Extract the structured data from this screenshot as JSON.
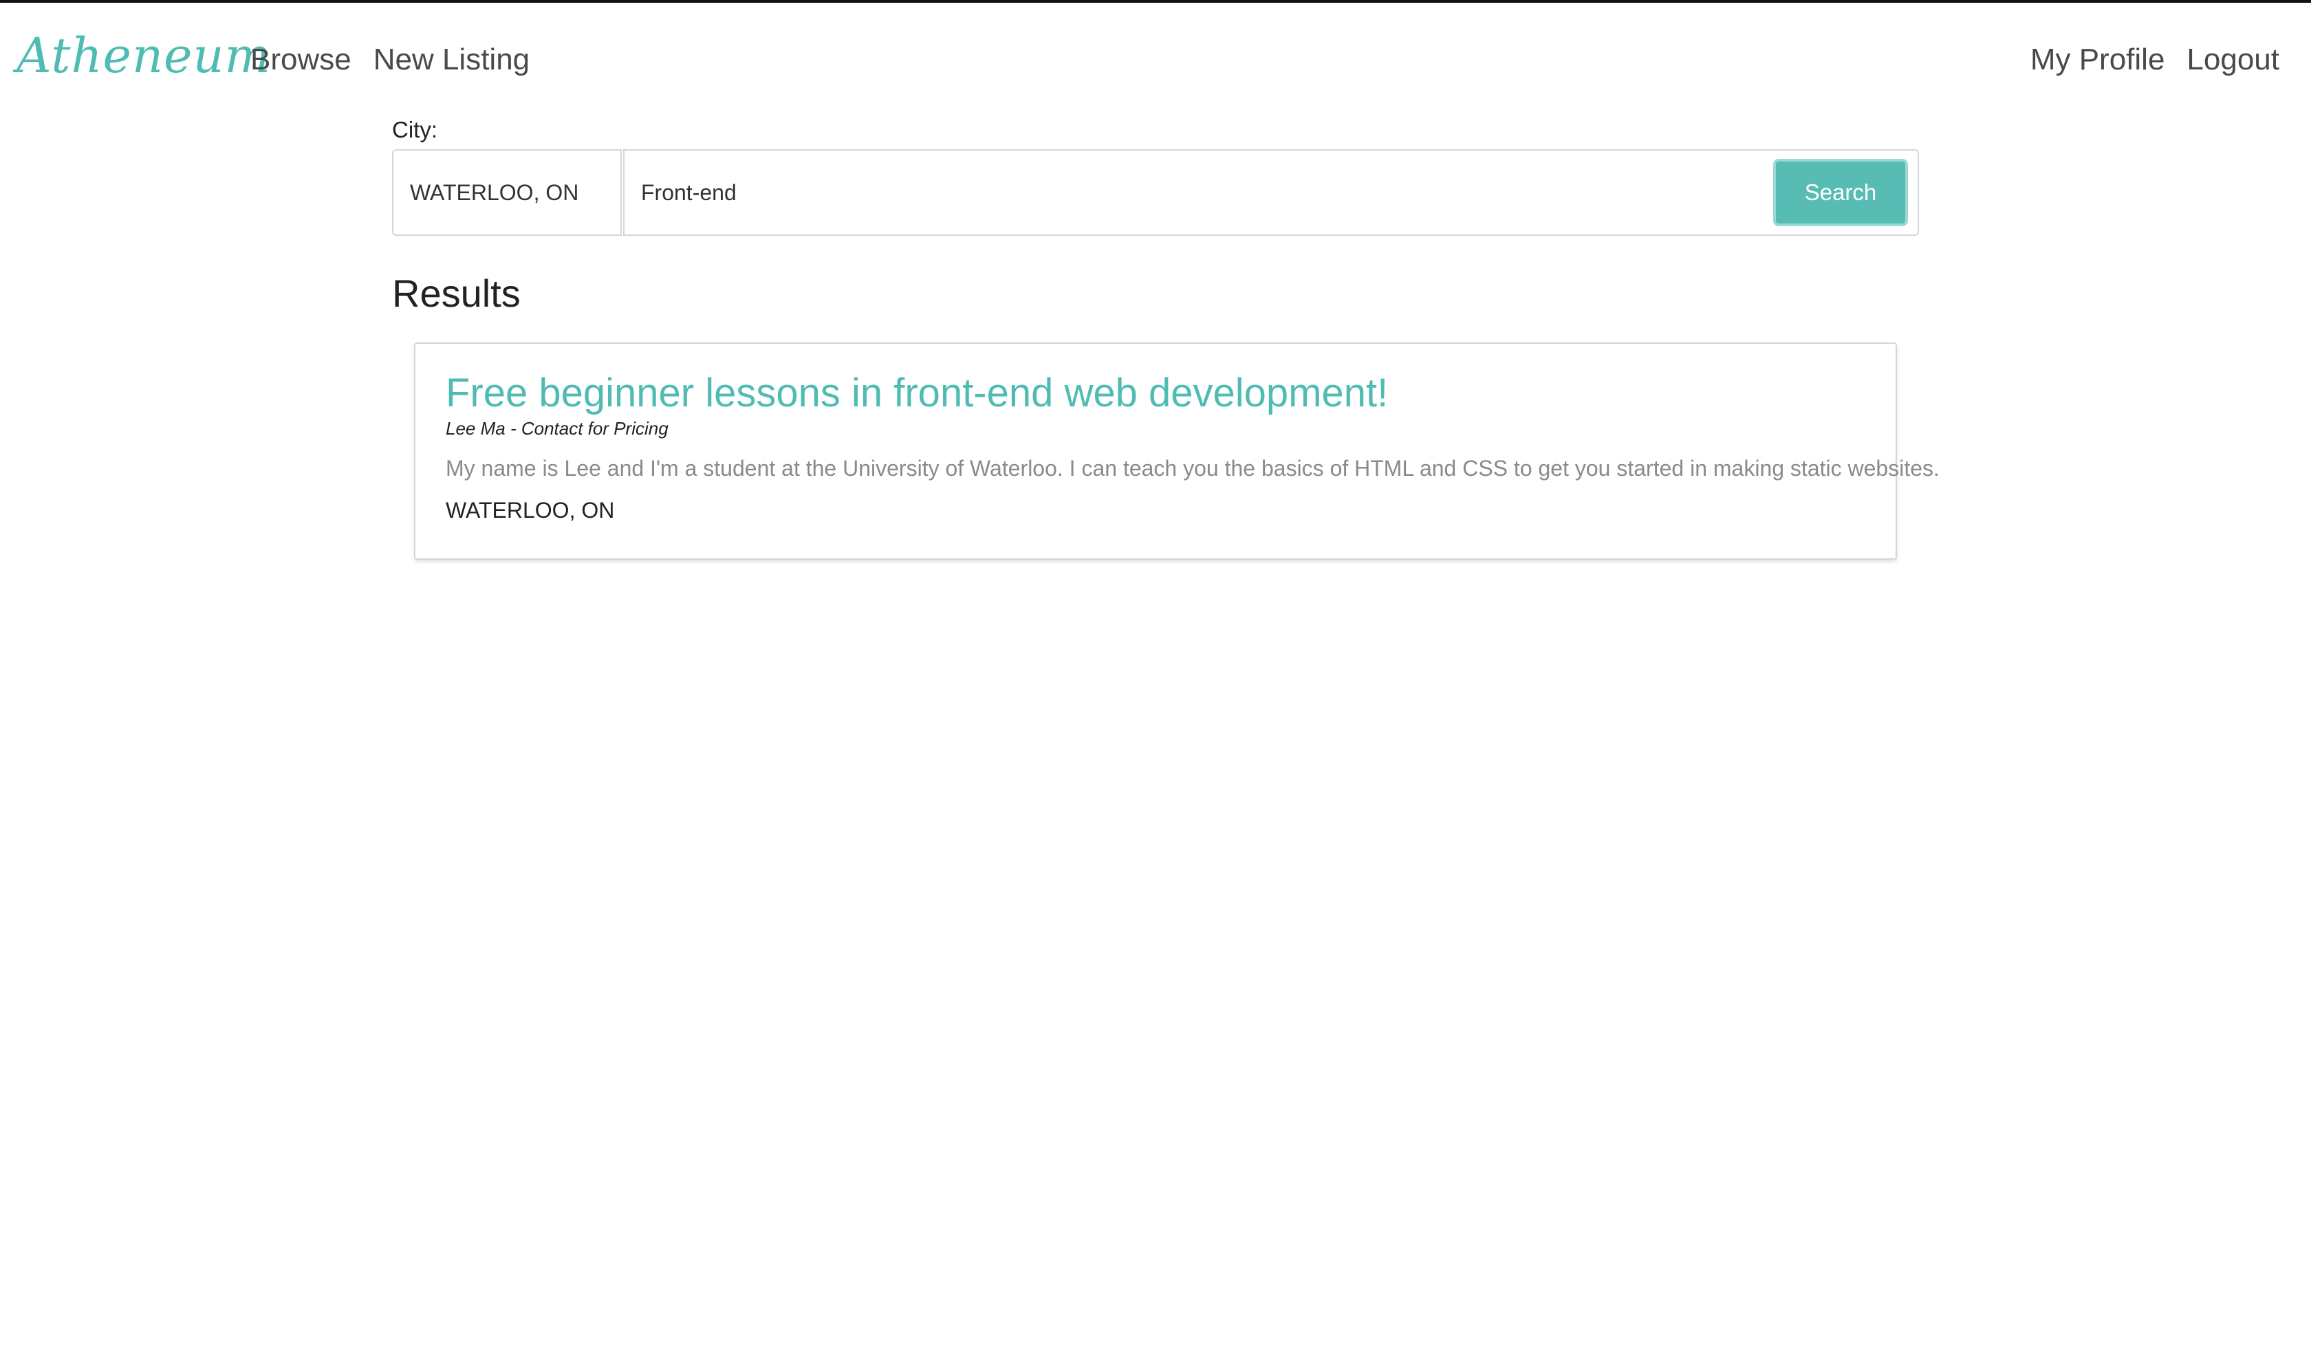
{
  "nav": {
    "logo": "Atheneum",
    "left_links": [
      "Browse",
      "New Listing"
    ],
    "right_links": [
      "My Profile",
      "Logout"
    ]
  },
  "search": {
    "city_label": "City:",
    "city_value": "WATERLOO, ON",
    "query_value": "Front-end",
    "button_label": "Search"
  },
  "results": {
    "heading": "Results",
    "items": [
      {
        "title": "Free beginner lessons in front-end web development!",
        "meta": "Lee Ma - Contact for Pricing",
        "description": "My name is Lee and I'm a student at the University of Waterloo. I can teach you the basics of HTML and CSS to get you started in making static websites.",
        "city": "WATERLOO, ON"
      }
    ]
  },
  "colors": {
    "brand": "#4fbcb3",
    "button": "#57bdb4"
  }
}
